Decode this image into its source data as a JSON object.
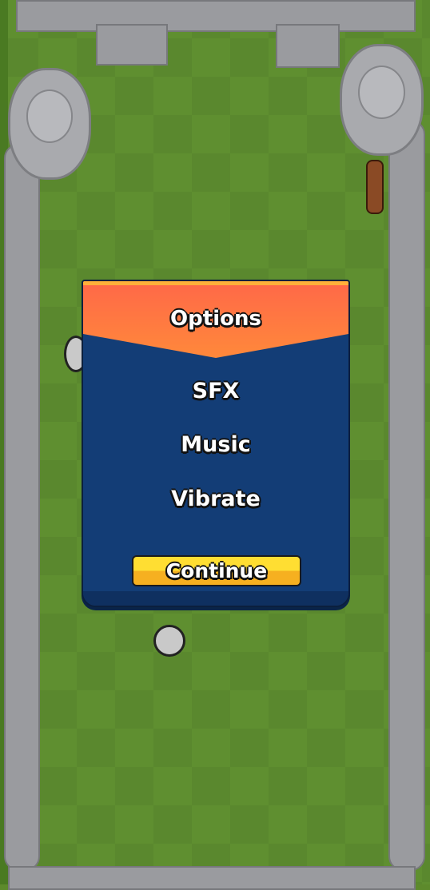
{
  "options_dialog": {
    "title": "Options",
    "items": [
      {
        "label": "SFX"
      },
      {
        "label": "Music"
      },
      {
        "label": "Vibrate"
      }
    ],
    "continue_label": "Continue"
  },
  "colors": {
    "header": "#ff6848",
    "panel": "#133d76",
    "button": "#ffde32",
    "grass": "#5f8f30",
    "stone": "#9a9b9f"
  }
}
